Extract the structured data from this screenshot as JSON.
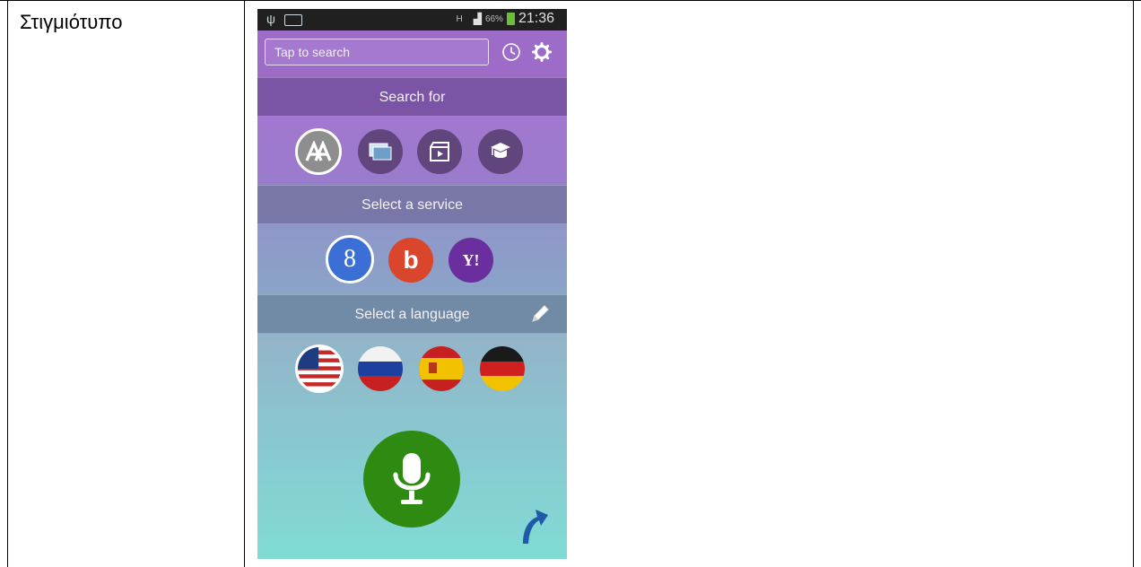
{
  "document": {
    "label": "Στιγμιότυπο"
  },
  "phone": {
    "status_bar": {
      "left_icons": [
        "usb-icon",
        "voicemail-icon"
      ],
      "network": "H",
      "battery_percent": "66%",
      "time": "21:36"
    },
    "search": {
      "placeholder": "Tap to search"
    },
    "sections": {
      "search_for": "Search for",
      "select_service": "Select a service",
      "select_language": "Select a language"
    },
    "search_types": [
      {
        "icon": "text-search-icon",
        "selected": true
      },
      {
        "icon": "image-search-icon",
        "selected": false
      },
      {
        "icon": "video-search-icon",
        "selected": false
      },
      {
        "icon": "scholar-search-icon",
        "selected": false
      }
    ],
    "services": [
      {
        "icon": "google-icon",
        "glyph": "8",
        "color": "#3b6fd6",
        "selected": true
      },
      {
        "icon": "bing-icon",
        "glyph": "b",
        "color": "#d9462b",
        "selected": false
      },
      {
        "icon": "yahoo-icon",
        "glyph": "Y!",
        "color": "#6a2e9e",
        "selected": false
      }
    ],
    "languages": [
      {
        "icon": "us-flag-icon",
        "selected": true
      },
      {
        "icon": "russia-flag-icon",
        "selected": false
      },
      {
        "icon": "spain-flag-icon",
        "selected": false
      },
      {
        "icon": "germany-flag-icon",
        "selected": false
      }
    ]
  }
}
